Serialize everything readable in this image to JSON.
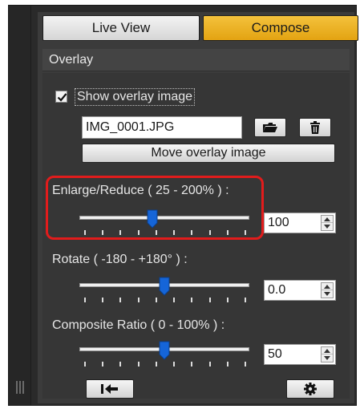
{
  "tabs": [
    {
      "label": "Live View",
      "active": false
    },
    {
      "label": "Compose",
      "active": true
    }
  ],
  "section": {
    "title": "Overlay"
  },
  "overlay": {
    "show_label": "Show overlay image",
    "show_checked": true,
    "filename": "IMG_0001.JPG",
    "move_button": "Move overlay image",
    "folder_icon": "folder-open-icon",
    "trash_icon": "trash-icon"
  },
  "enlarge": {
    "label": "Enlarge/Reduce ( 25 - 200% ) :",
    "value": "100",
    "slider_fraction": 0.43
  },
  "rotate": {
    "label": "Rotate ( -180 - +180° ) :",
    "value": "0.0",
    "slider_fraction": 0.5
  },
  "ratio": {
    "label": "Composite Ratio ( 0 - 100% ) :",
    "value": "50",
    "slider_fraction": 0.5
  },
  "bottom": {
    "reset_icon": "reset-arrow-icon",
    "settings_icon": "gear-icon"
  },
  "colors": {
    "accent": "#f0b526",
    "highlight": "#e11c1c",
    "slider_thumb": "#1565d8",
    "panel": "#3b3b3b"
  }
}
